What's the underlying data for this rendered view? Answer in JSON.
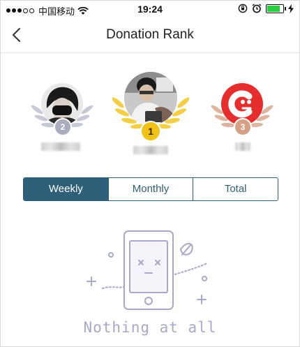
{
  "status_bar": {
    "carrier": "中国移动",
    "time": "19:24",
    "battery_level": 0.85,
    "battery_color": "#2ecc40"
  },
  "nav": {
    "title": "Donation Rank",
    "back_icon": "chevron-left-icon"
  },
  "podium": [
    {
      "rank": "2",
      "medal_color": "#a9adbd",
      "wreath_color": "#c7cad6"
    },
    {
      "rank": "1",
      "medal_color": "#f2c21b",
      "wreath_color": "#f3cf47"
    },
    {
      "rank": "3",
      "medal_color": "#d4a186",
      "wreath_color": "#dcb49f"
    }
  ],
  "tabs": {
    "items": [
      "Weekly",
      "Monthly",
      "Total"
    ],
    "active": "Weekly",
    "accent_color": "#2f6079"
  },
  "empty_state": {
    "text": "Nothing at all",
    "illustration": "sad-phone-illustration",
    "color": "#a8a8c8"
  }
}
